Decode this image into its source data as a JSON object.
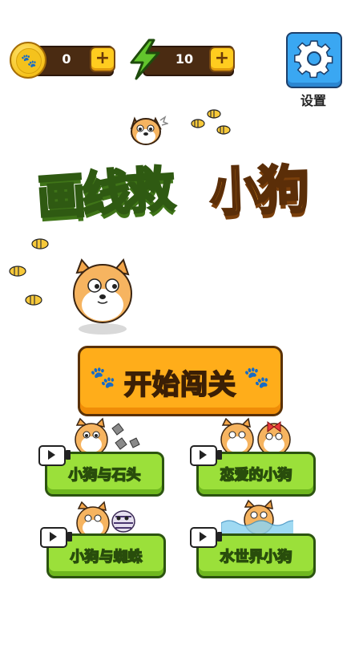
{
  "top_bar": {
    "coins": "0",
    "energy": "10",
    "plus_symbol": "+",
    "settings_label": "设置"
  },
  "title": {
    "part1": "画线救",
    "part2": "小狗"
  },
  "start_button": {
    "label": "开始闯关"
  },
  "modes": [
    {
      "label": "小狗与石头"
    },
    {
      "label": "恋爱的小狗"
    },
    {
      "label": "小狗与蜘蛛"
    },
    {
      "label": "水世界小狗"
    }
  ],
  "colors": {
    "accent_orange": "#ffad1a",
    "accent_green": "#9be03a",
    "settings_blue": "#3aa7f2"
  }
}
